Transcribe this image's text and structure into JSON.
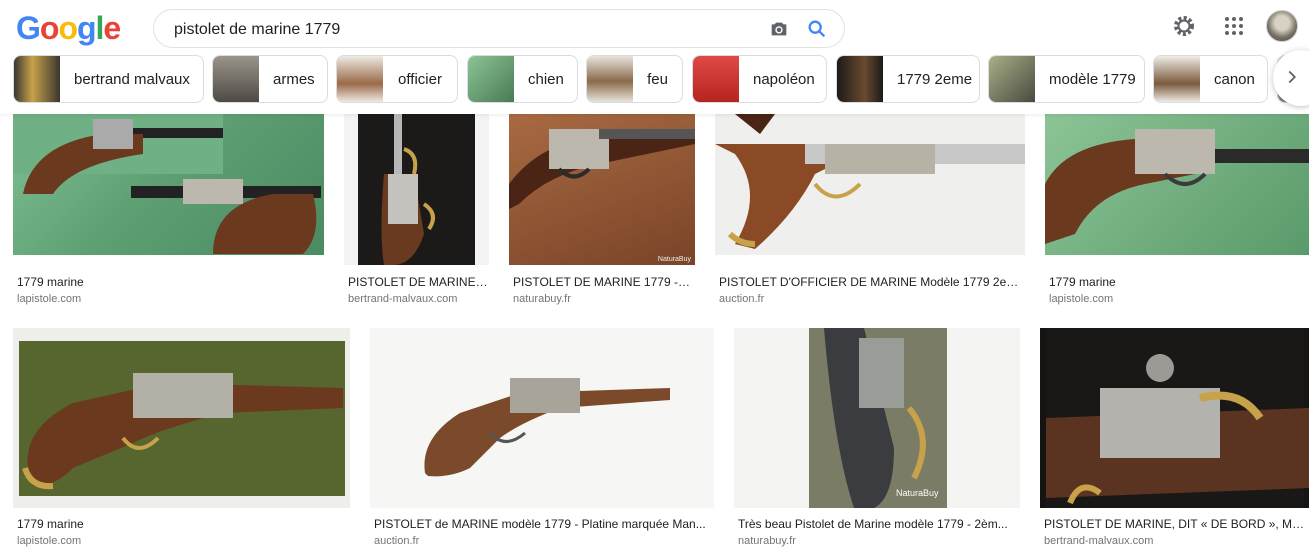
{
  "search": {
    "query": "pistolet de marine 1779"
  },
  "logo": [
    "G",
    "o",
    "o",
    "g",
    "l",
    "e"
  ],
  "chips": [
    {
      "label": "bertrand malvaux",
      "thumb": "#3a3630"
    },
    {
      "label": "armes",
      "thumb": "#6e6a62"
    },
    {
      "label": "officier",
      "thumb": "#c9c3b5"
    },
    {
      "label": "chien",
      "thumb": "#6aa06e"
    },
    {
      "label": "feu",
      "thumb": "#b9b2a4"
    },
    {
      "label": "napoléon",
      "thumb": "#d6322e"
    },
    {
      "label": "1779 2eme",
      "thumb": "#2c2a26"
    },
    {
      "label": "modèle 1779",
      "thumb": "#7c8a6a"
    },
    {
      "label": "canon",
      "thumb": "#8a7c6a"
    }
  ],
  "results_row1": [
    {
      "title": "1779 marine",
      "source": "lapistole.com",
      "bg": "#5fa37a"
    },
    {
      "title": "PISTOLET DE MARINE, ...",
      "source": "bertrand-malvaux.com",
      "bg": "#1e1c1a"
    },
    {
      "title": "PISTOLET DE MARINE 1779 - ...",
      "source": "naturabuy.fr",
      "bg": "#8a5a3a"
    },
    {
      "title": "PISTOLET D'OFFICIER DE MARINE Modèle 1779 2e ty...",
      "source": "auction.fr",
      "bg": "#ececea"
    },
    {
      "title": "1779 marine",
      "source": "lapistole.com",
      "bg": "#6fae76"
    }
  ],
  "results_row2": [
    {
      "title": "1779 marine",
      "source": "lapistole.com",
      "bg": "#4e5a2e"
    },
    {
      "title": "PISTOLET de MARINE modèle 1779 - Platine marquée Man...",
      "source": "auction.fr",
      "bg": "#f4f4f2"
    },
    {
      "title": "Très beau Pistolet de Marine modèle 1779 - 2èm...",
      "source": "naturabuy.fr",
      "bg": "#6a6a58"
    },
    {
      "title": "PISTOLET DE MARINE, DIT « DE BORD », MOD...",
      "source": "bertrand-malvaux.com",
      "bg": "#151412"
    }
  ],
  "watermarks": {
    "naturabuy": "NaturaBuy"
  },
  "icons": [
    "camera-icon",
    "search-icon",
    "gear-icon",
    "apps-grid-icon",
    "chevron-right-icon"
  ]
}
